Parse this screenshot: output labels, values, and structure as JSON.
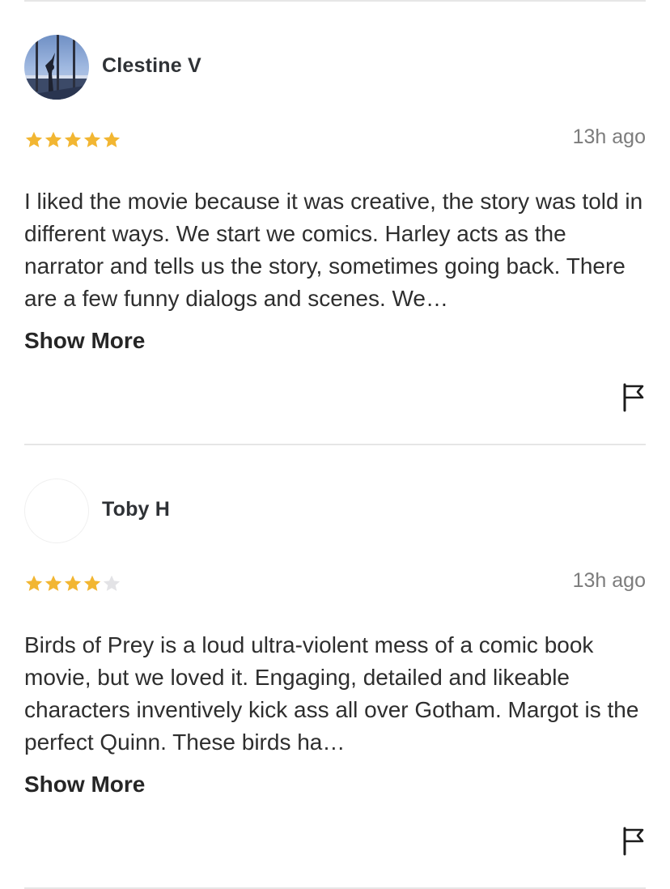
{
  "reviews": [
    {
      "user_name": "Clestine V",
      "avatar": "photo-avatar",
      "rating": 5,
      "max_rating": 5,
      "timestamp": "13h ago",
      "text": "I liked the movie because it was creative, the story was told in different ways. We start we comics. Harley acts as the narrator and tells us the story, sometimes going back. There are a few funny dialogs and scenes. We…",
      "show_more_label": "Show More",
      "flag_icon": "flag-icon"
    },
    {
      "user_name": "Toby H",
      "avatar": "blank-avatar",
      "rating": 4,
      "max_rating": 5,
      "timestamp": "13h ago",
      "text": "Birds of Prey is a loud ultra-violent mess of a comic book movie, but we loved it. Engaging, detailed and likeable characters inventively kick ass all over Gotham. Margot is the perfect Quinn. These birds ha…",
      "show_more_label": "Show More",
      "flag_icon": "flag-icon"
    }
  ],
  "colors": {
    "star_filled": "#f2b632",
    "star_empty": "#e3e3e6",
    "divider": "#e6e6e6",
    "timestamp": "#7c7c7c"
  }
}
